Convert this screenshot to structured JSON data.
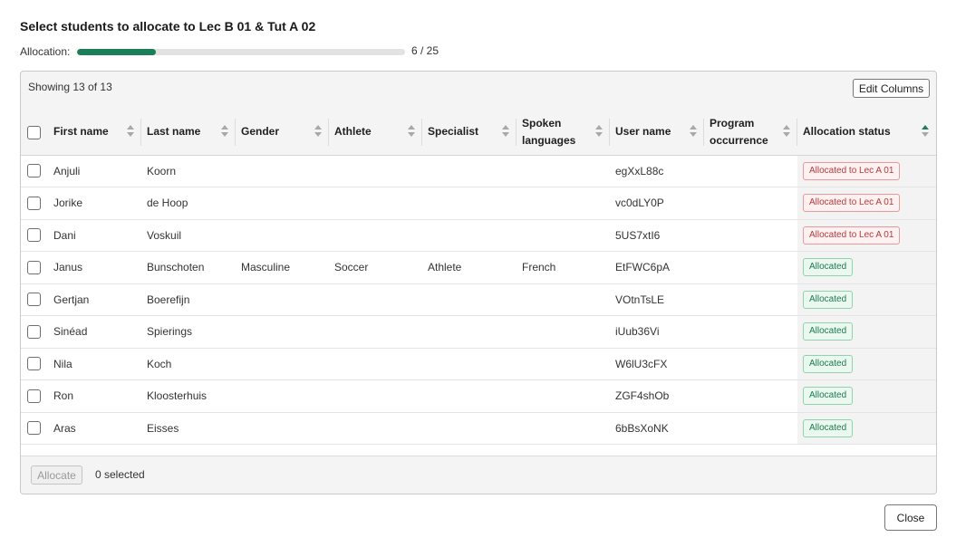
{
  "dialog": {
    "title": "Select students to allocate to Lec B 01 & Tut A 02",
    "allocation_label": "Allocation:",
    "allocation_count": "6 / 25",
    "allocation_fraction": 0.24,
    "close_label": "Close"
  },
  "table": {
    "showing_text": "Showing 13 of 13",
    "edit_columns_label": "Edit Columns",
    "columns": [
      {
        "label": "First name",
        "sort": "none"
      },
      {
        "label": "Last name",
        "sort": "none"
      },
      {
        "label": "Gender",
        "sort": "none"
      },
      {
        "label": "Athlete",
        "sort": "none"
      },
      {
        "label": "Specialist",
        "sort": "none"
      },
      {
        "label": "Spoken languages",
        "sort": "none"
      },
      {
        "label": "User name",
        "sort": "none"
      },
      {
        "label": "Program occurrence",
        "sort": "none"
      },
      {
        "label": "Allocation status",
        "sort": "ascending"
      }
    ],
    "rows": [
      {
        "first": "Anjuli",
        "last": "Koorn",
        "gender": "",
        "athlete": "",
        "specialist": "",
        "languages": "",
        "username": "egXxL88c",
        "program": "",
        "status": "Allocated to Lec A 01",
        "status_color": "red"
      },
      {
        "first": "Jorike",
        "last": "de Hoop",
        "gender": "",
        "athlete": "",
        "specialist": "",
        "languages": "",
        "username": "vc0dLY0P",
        "program": "",
        "status": "Allocated to Lec A 01",
        "status_color": "red"
      },
      {
        "first": "Dani",
        "last": "Voskuil",
        "gender": "",
        "athlete": "",
        "specialist": "",
        "languages": "",
        "username": "5US7xtI6",
        "program": "",
        "status": "Allocated to Lec A 01",
        "status_color": "red"
      },
      {
        "first": "Janus",
        "last": "Bunschoten",
        "gender": "Masculine",
        "athlete": "Soccer",
        "specialist": "Athlete",
        "languages": "French",
        "username": "EtFWC6pA",
        "program": "",
        "status": "Allocated",
        "status_color": "green"
      },
      {
        "first": "Gertjan",
        "last": "Boerefijn",
        "gender": "",
        "athlete": "",
        "specialist": "",
        "languages": "",
        "username": "VOtnTsLE",
        "program": "",
        "status": "Allocated",
        "status_color": "green"
      },
      {
        "first": "Sinéad",
        "last": "Spierings",
        "gender": "",
        "athlete": "",
        "specialist": "",
        "languages": "",
        "username": "iUub36Vi",
        "program": "",
        "status": "Allocated",
        "status_color": "green"
      },
      {
        "first": "Nila",
        "last": "Koch",
        "gender": "",
        "athlete": "",
        "specialist": "",
        "languages": "",
        "username": "W6lU3cFX",
        "program": "",
        "status": "Allocated",
        "status_color": "green"
      },
      {
        "first": "Ron",
        "last": "Kloosterhuis",
        "gender": "",
        "athlete": "",
        "specialist": "",
        "languages": "",
        "username": "ZGF4shOb",
        "program": "",
        "status": "Allocated",
        "status_color": "green"
      },
      {
        "first": "Aras",
        "last": "Eisses",
        "gender": "",
        "athlete": "",
        "specialist": "",
        "languages": "",
        "username": "6bBsXoNK",
        "program": "",
        "status": "Allocated",
        "status_color": "green"
      }
    ]
  },
  "footer": {
    "allocate_label": "Allocate",
    "selected_text": "0 selected"
  },
  "colors": {
    "accent": "#1d7f5a",
    "badge_red": "#b43a3a",
    "badge_green": "#1d7a4f"
  }
}
